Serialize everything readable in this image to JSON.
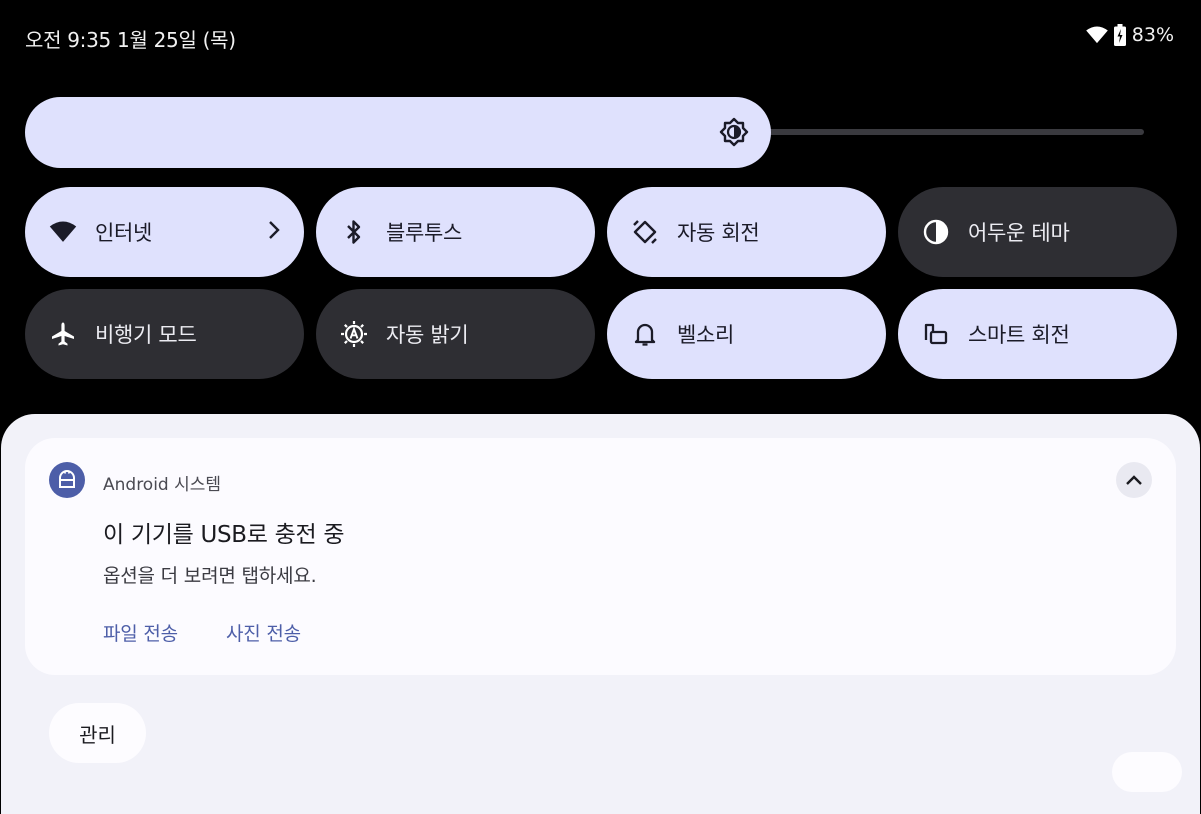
{
  "status_bar": {
    "time_date": "오전 9:35 1월 25일 (목)",
    "battery_percent": "83%",
    "icons": [
      "wifi-icon",
      "battery-icon"
    ]
  },
  "brightness": {
    "level_fraction": 0.64,
    "icon": "brightness-icon"
  },
  "tiles": [
    {
      "label": "인터넷",
      "icon": "wifi-icon",
      "state": "on",
      "has_chevron": true
    },
    {
      "label": "블루투스",
      "icon": "bluetooth-icon",
      "state": "on"
    },
    {
      "label": "자동 회전",
      "icon": "auto-rotate-icon",
      "state": "on"
    },
    {
      "label": "어두운 테마",
      "icon": "dark-theme-icon",
      "state": "off"
    },
    {
      "label": "비행기 모드",
      "icon": "airplane-icon",
      "state": "off"
    },
    {
      "label": "자동 밝기",
      "icon": "auto-brightness-icon",
      "state": "off"
    },
    {
      "label": "벨소리",
      "icon": "bell-icon",
      "state": "on"
    },
    {
      "label": "스마트 회전",
      "icon": "smart-rotate-icon",
      "state": "on"
    }
  ],
  "notification": {
    "app_name": "Android 시스템",
    "title": "이 기기를 USB로 충전 중",
    "body": "옵션을 더 보려면 탭하세요.",
    "actions": [
      "파일 전송",
      "사진 전송"
    ]
  },
  "manage_label": "관리",
  "colors": {
    "background": "#000000",
    "tile_on": "#dfe1fd",
    "tile_off": "#2e2e33",
    "accent": "#4d5ea8",
    "shade": "#f2f2f9"
  }
}
